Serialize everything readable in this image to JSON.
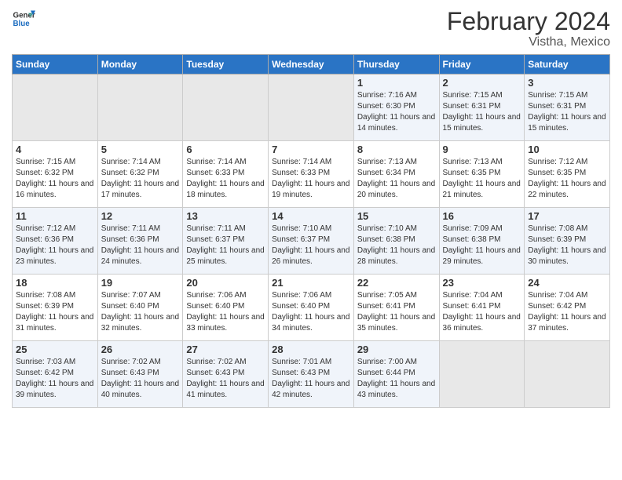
{
  "header": {
    "logo_general": "General",
    "logo_blue": "Blue",
    "title": "February 2024",
    "subtitle": "Vistha, Mexico"
  },
  "days_of_week": [
    "Sunday",
    "Monday",
    "Tuesday",
    "Wednesday",
    "Thursday",
    "Friday",
    "Saturday"
  ],
  "weeks": [
    [
      {
        "day": "",
        "sunrise": "",
        "sunset": "",
        "daylight": "",
        "empty": true
      },
      {
        "day": "",
        "sunrise": "",
        "sunset": "",
        "daylight": "",
        "empty": true
      },
      {
        "day": "",
        "sunrise": "",
        "sunset": "",
        "daylight": "",
        "empty": true
      },
      {
        "day": "",
        "sunrise": "",
        "sunset": "",
        "daylight": "",
        "empty": true
      },
      {
        "day": "1",
        "sunrise": "7:16 AM",
        "sunset": "6:30 PM",
        "daylight": "11 hours and 14 minutes."
      },
      {
        "day": "2",
        "sunrise": "7:15 AM",
        "sunset": "6:31 PM",
        "daylight": "11 hours and 15 minutes."
      },
      {
        "day": "3",
        "sunrise": "7:15 AM",
        "sunset": "6:31 PM",
        "daylight": "11 hours and 15 minutes."
      }
    ],
    [
      {
        "day": "4",
        "sunrise": "7:15 AM",
        "sunset": "6:32 PM",
        "daylight": "11 hours and 16 minutes."
      },
      {
        "day": "5",
        "sunrise": "7:14 AM",
        "sunset": "6:32 PM",
        "daylight": "11 hours and 17 minutes."
      },
      {
        "day": "6",
        "sunrise": "7:14 AM",
        "sunset": "6:33 PM",
        "daylight": "11 hours and 18 minutes."
      },
      {
        "day": "7",
        "sunrise": "7:14 AM",
        "sunset": "6:33 PM",
        "daylight": "11 hours and 19 minutes."
      },
      {
        "day": "8",
        "sunrise": "7:13 AM",
        "sunset": "6:34 PM",
        "daylight": "11 hours and 20 minutes."
      },
      {
        "day": "9",
        "sunrise": "7:13 AM",
        "sunset": "6:35 PM",
        "daylight": "11 hours and 21 minutes."
      },
      {
        "day": "10",
        "sunrise": "7:12 AM",
        "sunset": "6:35 PM",
        "daylight": "11 hours and 22 minutes."
      }
    ],
    [
      {
        "day": "11",
        "sunrise": "7:12 AM",
        "sunset": "6:36 PM",
        "daylight": "11 hours and 23 minutes."
      },
      {
        "day": "12",
        "sunrise": "7:11 AM",
        "sunset": "6:36 PM",
        "daylight": "11 hours and 24 minutes."
      },
      {
        "day": "13",
        "sunrise": "7:11 AM",
        "sunset": "6:37 PM",
        "daylight": "11 hours and 25 minutes."
      },
      {
        "day": "14",
        "sunrise": "7:10 AM",
        "sunset": "6:37 PM",
        "daylight": "11 hours and 26 minutes."
      },
      {
        "day": "15",
        "sunrise": "7:10 AM",
        "sunset": "6:38 PM",
        "daylight": "11 hours and 28 minutes."
      },
      {
        "day": "16",
        "sunrise": "7:09 AM",
        "sunset": "6:38 PM",
        "daylight": "11 hours and 29 minutes."
      },
      {
        "day": "17",
        "sunrise": "7:08 AM",
        "sunset": "6:39 PM",
        "daylight": "11 hours and 30 minutes."
      }
    ],
    [
      {
        "day": "18",
        "sunrise": "7:08 AM",
        "sunset": "6:39 PM",
        "daylight": "11 hours and 31 minutes."
      },
      {
        "day": "19",
        "sunrise": "7:07 AM",
        "sunset": "6:40 PM",
        "daylight": "11 hours and 32 minutes."
      },
      {
        "day": "20",
        "sunrise": "7:06 AM",
        "sunset": "6:40 PM",
        "daylight": "11 hours and 33 minutes."
      },
      {
        "day": "21",
        "sunrise": "7:06 AM",
        "sunset": "6:40 PM",
        "daylight": "11 hours and 34 minutes."
      },
      {
        "day": "22",
        "sunrise": "7:05 AM",
        "sunset": "6:41 PM",
        "daylight": "11 hours and 35 minutes."
      },
      {
        "day": "23",
        "sunrise": "7:04 AM",
        "sunset": "6:41 PM",
        "daylight": "11 hours and 36 minutes."
      },
      {
        "day": "24",
        "sunrise": "7:04 AM",
        "sunset": "6:42 PM",
        "daylight": "11 hours and 37 minutes."
      }
    ],
    [
      {
        "day": "25",
        "sunrise": "7:03 AM",
        "sunset": "6:42 PM",
        "daylight": "11 hours and 39 minutes."
      },
      {
        "day": "26",
        "sunrise": "7:02 AM",
        "sunset": "6:43 PM",
        "daylight": "11 hours and 40 minutes."
      },
      {
        "day": "27",
        "sunrise": "7:02 AM",
        "sunset": "6:43 PM",
        "daylight": "11 hours and 41 minutes."
      },
      {
        "day": "28",
        "sunrise": "7:01 AM",
        "sunset": "6:43 PM",
        "daylight": "11 hours and 42 minutes."
      },
      {
        "day": "29",
        "sunrise": "7:00 AM",
        "sunset": "6:44 PM",
        "daylight": "11 hours and 43 minutes."
      },
      {
        "day": "",
        "sunrise": "",
        "sunset": "",
        "daylight": "",
        "empty": true
      },
      {
        "day": "",
        "sunrise": "",
        "sunset": "",
        "daylight": "",
        "empty": true
      }
    ]
  ],
  "labels": {
    "sunrise": "Sunrise:",
    "sunset": "Sunset:",
    "daylight": "Daylight:"
  }
}
